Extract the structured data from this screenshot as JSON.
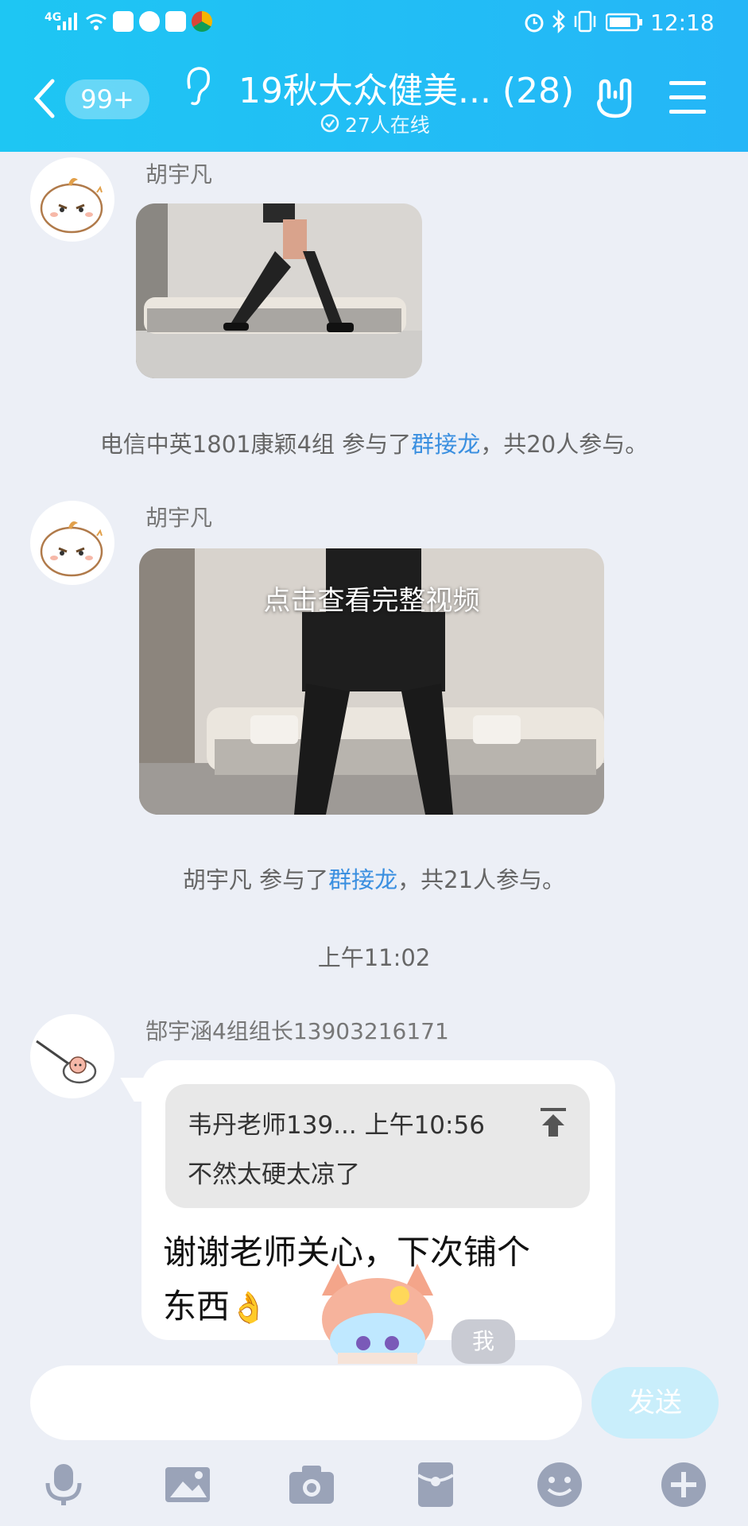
{
  "status_bar": {
    "network": "4G",
    "time": "12:18"
  },
  "header": {
    "unread_badge": "99+",
    "title": "19秋大众健美... (28)",
    "online": "27人在线"
  },
  "messages": [
    {
      "sender": "胡宇凡"
    },
    {
      "system": {
        "prefix": "电信中英1801康颖4组 参与了",
        "link": "群接龙",
        "suffix": "，共20人参与。"
      }
    },
    {
      "sender": "胡宇凡",
      "video_overlay": "点击查看完整视频"
    },
    {
      "system": {
        "prefix": "胡宇凡 参与了",
        "link": "群接龙",
        "suffix": "，共21人参与。"
      }
    },
    {
      "time": "上午11:02"
    },
    {
      "sender": "郜宇涵4组组长13903216171",
      "quote": {
        "header": "韦丹老师139... 上午10:56",
        "text": "不然太硬太凉了"
      },
      "text_line1": "谢谢老师关心，下次铺个",
      "text_line2": "东西",
      "emoji": "👌"
    }
  ],
  "sticker_label": "我",
  "input": {
    "placeholder": "",
    "send_label": "发送"
  },
  "toolbar": [
    "mic-icon",
    "image-icon",
    "camera-icon",
    "red-packet-icon",
    "emoji-icon",
    "plus-icon"
  ],
  "colors": {
    "header": "#1ec6f3",
    "link": "#3a8fe0",
    "background": "#eceff6",
    "toolbar_icon": "#9aa3b8"
  }
}
